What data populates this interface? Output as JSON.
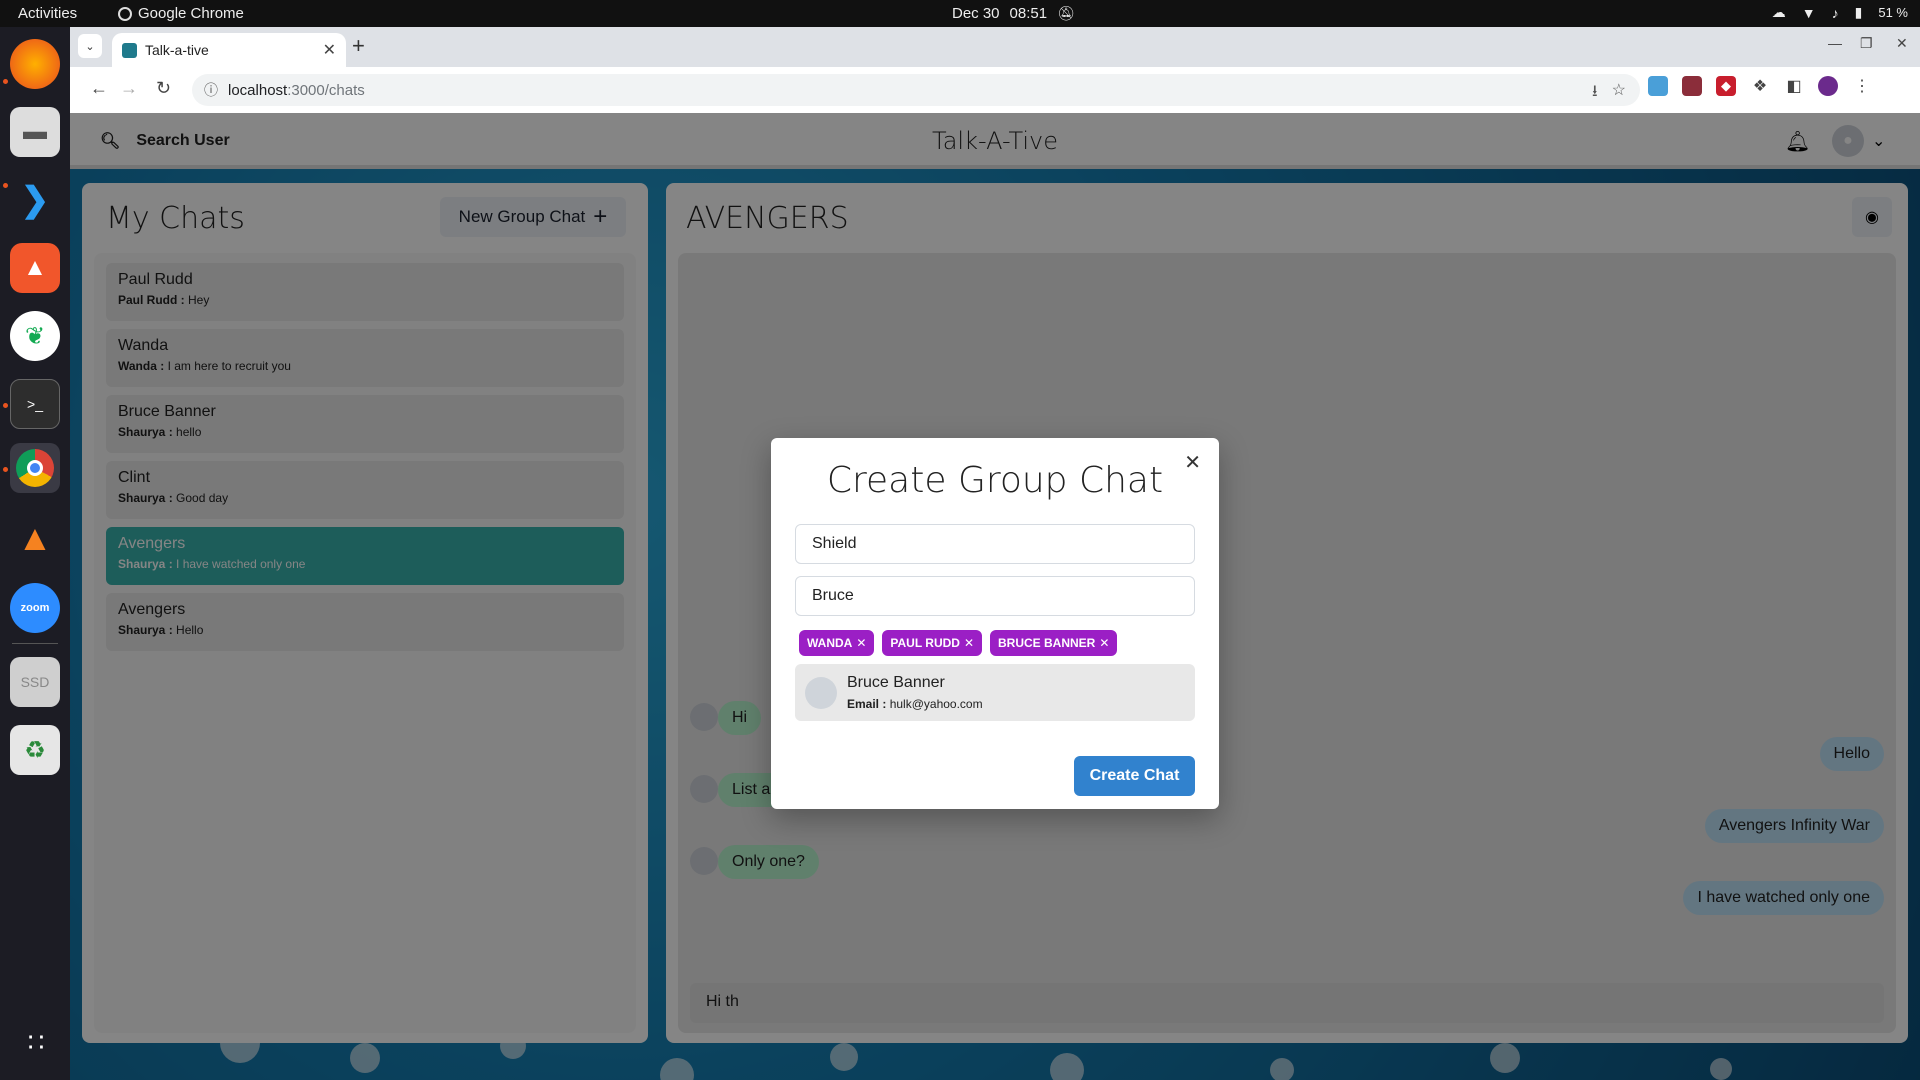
{
  "os": {
    "activities": "Activities",
    "active_app": "Google Chrome",
    "date": "Dec 30",
    "time": "08:51",
    "battery": "51 %"
  },
  "browser": {
    "tab_title": "Talk-a-tive",
    "url_host": "localhost",
    "url_path": ":3000/chats"
  },
  "app": {
    "search_label": "Search User",
    "title": "Talk-A-Tive"
  },
  "my_chats": {
    "title": "My Chats",
    "new_group_label": "New Group Chat",
    "items": [
      {
        "name": "Paul Rudd",
        "sender": "Paul Rudd :",
        "text": "Hey"
      },
      {
        "name": "Wanda",
        "sender": "Wanda :",
        "text": "I am here to recruit you"
      },
      {
        "name": "Bruce Banner",
        "sender": "Shaurya :",
        "text": "hello"
      },
      {
        "name": "Clint",
        "sender": "Shaurya :",
        "text": "Good day"
      },
      {
        "name": "Avengers",
        "sender": "Shaurya :",
        "text": "I have watched only one"
      },
      {
        "name": "Avengers",
        "sender": "Shaurya :",
        "text": "Hello"
      }
    ]
  },
  "chat": {
    "title": "AVENGERS",
    "messages": [
      {
        "text": "Hi"
      },
      {
        "text": "Hello"
      },
      {
        "text": "List all the MCU movies"
      },
      {
        "text": "Avengers Infinity War"
      },
      {
        "text": "Only one?"
      },
      {
        "text": "I have watched only one"
      }
    ],
    "input_value": "Hi th"
  },
  "modal": {
    "title": "Create Group Chat",
    "chat_name_value": "Shield",
    "add_users_value": "Bruce",
    "selected_users": [
      "WANDA",
      "PAUL RUDD",
      "BRUCE BANNER"
    ],
    "result": {
      "name": "Bruce Banner",
      "email_label": "Email :",
      "email": "hulk@yahoo.com"
    },
    "create_label": "Create Chat"
  }
}
